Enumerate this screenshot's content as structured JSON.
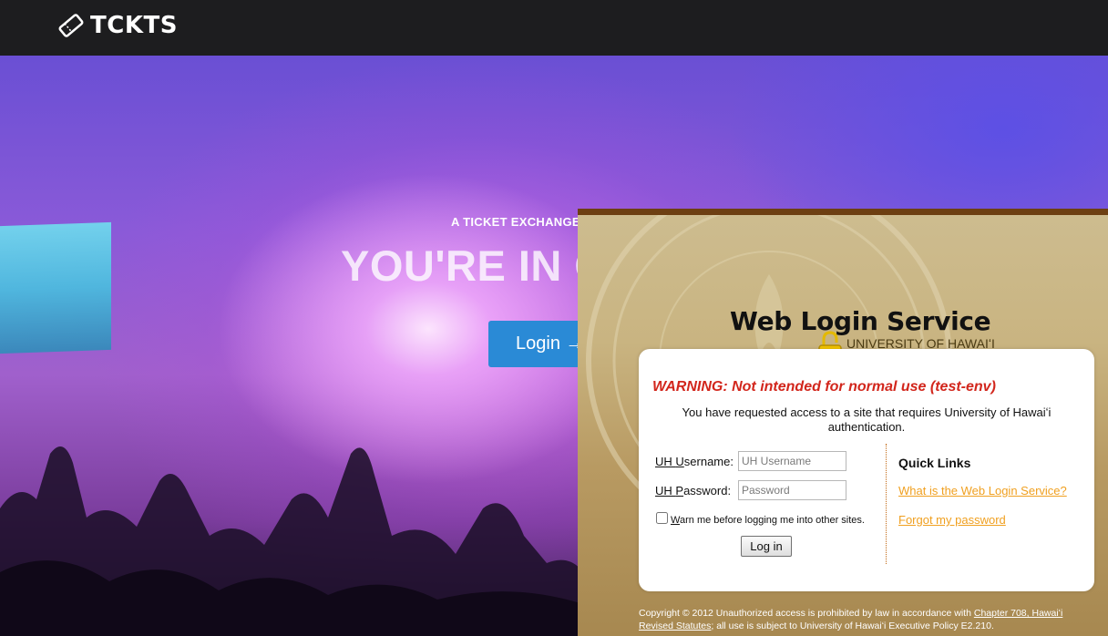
{
  "navbar": {
    "brand": "TCKTS",
    "brand_icon": "ticket-icon"
  },
  "hero": {
    "tagline": "A TICKET EXCHANGE",
    "title": "YOU'RE IN C",
    "login_button": "Login  →"
  },
  "web_login": {
    "title": "Web Login Service",
    "subtitle": "UNIVERSITY OF HAWAIʻI",
    "lock_icon": "padlock-icon",
    "warning": "WARNING: Not intended for normal use (test-env)",
    "intro": "You have requested access to a site that requires University of Hawaiʻi authentication.",
    "username_label_access": "U",
    "username_label_rest": "sername:",
    "username_prefix": "UH ",
    "username_placeholder": "UH Username",
    "password_prefix": "UH ",
    "password_label_access": "P",
    "password_label_rest": "assword:",
    "password_placeholder": "Password",
    "warn_checkbox_label_access": "W",
    "warn_checkbox_label_rest": "arn me before logging me into other sites.",
    "login_button": "Log in",
    "quick_links_title": "Quick Links",
    "quick_links": [
      "What is the Web Login Service?",
      "Forgot my password"
    ],
    "footer_text_1": "Copyright © 2012 Unauthorized access is prohibited by law in accordance with ",
    "footer_link_1": "Chapter 708, Hawaiʻi Revised Statutes",
    "footer_text_2": "; all use is subject to University of Hawaiʻi Executive Policy E2.210.",
    "colors": {
      "warning": "#d2261c",
      "link": "#f0a020",
      "top_border": "#6d3f12",
      "hero_button": "#2a8ad6"
    }
  }
}
